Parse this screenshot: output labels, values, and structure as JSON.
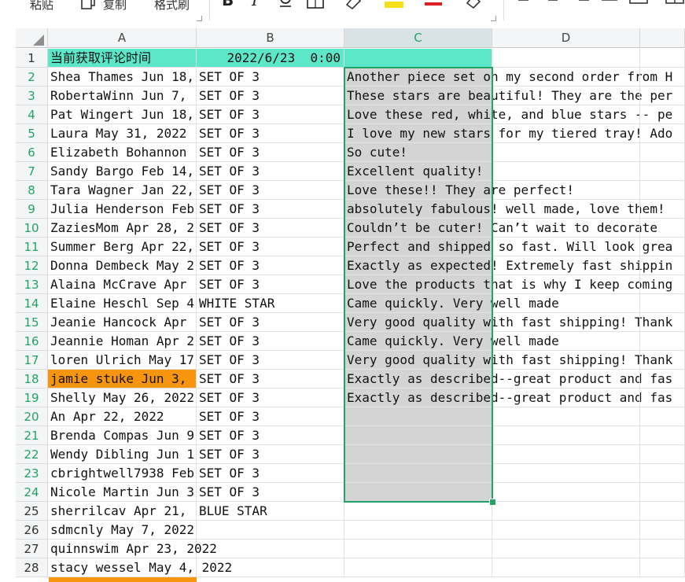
{
  "ribbon": {
    "paste_label": "粘贴",
    "copy_label": "复制",
    "format_painter_label": "格式刷"
  },
  "columns": [
    "A",
    "B",
    "C",
    "D"
  ],
  "rows": [
    {
      "num": "1",
      "a": "当前获取评论时间",
      "b": "2022/6/23  0:00",
      "c": "",
      "d": "",
      "a_hl": "teal",
      "b_hl": "teal",
      "c_hl": "teal"
    },
    {
      "num": "2",
      "a": "Shea Thames Jun 18,",
      "b": "SET OF 3",
      "c": "Another piece set on my second order from H",
      "d": ""
    },
    {
      "num": "3",
      "a": "RobertaWinn Jun 7,",
      "b": "SET OF 3",
      "c": "These stars are beautiful! They are the per",
      "d": ""
    },
    {
      "num": "4",
      "a": "Pat Wingert Jun 18,",
      "b": "SET OF 3",
      "c": "Love these red, white, and blue stars -- pe",
      "d": ""
    },
    {
      "num": "5",
      "a": "Laura May 31, 2022",
      "b": "SET OF 3",
      "c": "I love my new stars for my tiered tray! Ado",
      "d": ""
    },
    {
      "num": "6",
      "a": "Elizabeth Bohannon",
      "b": "SET OF 3",
      "c": "So cute!",
      "d": ""
    },
    {
      "num": "7",
      "a": "Sandy Bargo Feb 14,",
      "b": "SET OF 3",
      "c": "Excellent quality!",
      "d": ""
    },
    {
      "num": "8",
      "a": "Tara Wagner Jan 22,",
      "b": "SET OF 3",
      "c": "Love these!! They are perfect!",
      "d": ""
    },
    {
      "num": "9",
      "a": "Julia Henderson Feb",
      "b": "SET OF 3",
      "c": "absolutely fabulous! well made, love them!",
      "d": ""
    },
    {
      "num": "10",
      "a": "ZaziesMom Apr 28, 2",
      "b": "SET OF 3",
      "c": "Couldn’t be cuter! Can’t wait to decorate",
      "d": ""
    },
    {
      "num": "11",
      "a": "Summer Berg Apr 22,",
      "b": "SET OF 3",
      "c": "Perfect and shipped so fast. Will look grea",
      "d": ""
    },
    {
      "num": "12",
      "a": "Donna Dembeck May 2",
      "b": "SET OF 3",
      "c": "Exactly as expected! Extremely fast shippin",
      "d": ""
    },
    {
      "num": "13",
      "a": "Alaina McCrave Apr",
      "b": "SET OF 3",
      "c": "Love the products that is why I keep coming",
      "d": ""
    },
    {
      "num": "14",
      "a": "Elaine Heschl Sep 4",
      "b": "WHITE STAR",
      "c": "Came quickly. Very well made",
      "d": ""
    },
    {
      "num": "15",
      "a": "Jeanie Hancock Apr",
      "b": "SET OF 3",
      "c": "Very good quality with fast shipping! Thank",
      "d": ""
    },
    {
      "num": "16",
      "a": "Jeannie Homan Apr 2",
      "b": "SET OF 3",
      "c": "Came quickly. Very well made",
      "d": ""
    },
    {
      "num": "17",
      "a": "loren Ulrich May 17",
      "b": "SET OF 3",
      "c": "Very good quality with fast shipping! Thank",
      "d": ""
    },
    {
      "num": "18",
      "a": "jamie stuke Jun 3, ",
      "b": "SET OF 3",
      "c": "Exactly as described--great product and fas",
      "d": "",
      "a_hl": "orange"
    },
    {
      "num": "19",
      "a": "Shelly May 26, 2022",
      "b": "SET OF 3",
      "c": "Exactly as described--great product and fas",
      "d": ""
    },
    {
      "num": "20",
      "a": "An Apr 22, 2022",
      "b": "SET OF 3",
      "c": "",
      "d": ""
    },
    {
      "num": "21",
      "a": "Brenda Compas Jun 9",
      "b": "SET OF 3",
      "c": "",
      "d": ""
    },
    {
      "num": "22",
      "a": "Wendy Dibling Jun 1",
      "b": "SET OF 3",
      "c": "",
      "d": ""
    },
    {
      "num": "23",
      "a": "cbrightwell7938 Feb",
      "b": "SET OF 3",
      "c": "",
      "d": ""
    },
    {
      "num": "24",
      "a": "Nicole Martin Jun 3",
      "b": "SET OF 3",
      "c": "",
      "d": ""
    },
    {
      "num": "25",
      "a": "sherrilcav Apr 21, ",
      "b": "BLUE STAR",
      "c": "",
      "d": ""
    },
    {
      "num": "26",
      "a": "sdmcnly May 7, 2022",
      "b": "",
      "c": "",
      "d": ""
    },
    {
      "num": "27",
      "a": "quinnswim Apr 23, 2022",
      "b": "",
      "c": "",
      "d": ""
    },
    {
      "num": "28",
      "a": "stacy wessel May 4, 2022",
      "b": "",
      "c": "",
      "d": ""
    }
  ],
  "selection": {
    "column": "C",
    "first_row": 2,
    "last_row": 24
  },
  "colors": {
    "accent": "#21a366",
    "teal_fill": "#5ce8c8",
    "orange_fill": "#f7960e",
    "selection_fill": "#d4d4d4"
  }
}
